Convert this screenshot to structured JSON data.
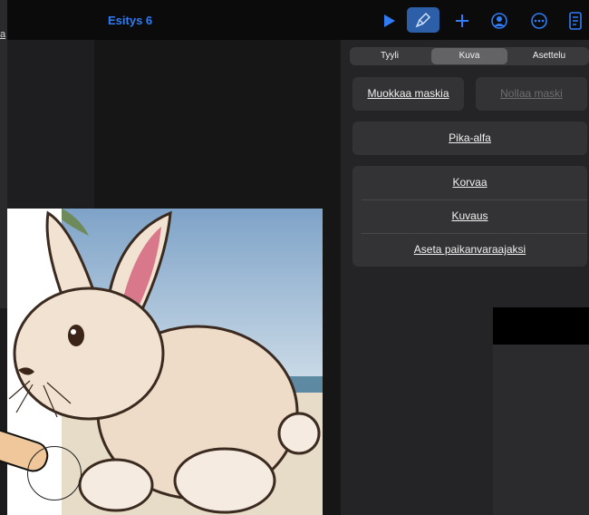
{
  "app": {
    "document_title": "Esitys 6",
    "partial_left_label": "a"
  },
  "toolbar": {
    "icons": [
      "play-icon",
      "format-brush-icon",
      "plus-icon",
      "collaborate-icon",
      "more-icon",
      "document-options-icon"
    ],
    "accent": "#2f7cf6"
  },
  "inspector": {
    "tabs": [
      {
        "label": "Tyyli",
        "selected": false
      },
      {
        "label": "Kuva",
        "selected": true
      },
      {
        "label": "Asettelu",
        "selected": false
      }
    ],
    "edit_mask": "Muokkaa maskia",
    "reset_mask": "Nollaa maski",
    "instant_alpha": "Pika-alfa",
    "group_items": [
      "Korvaa",
      "Kuvaus",
      "Aseta paikanvaraajaksi"
    ]
  }
}
